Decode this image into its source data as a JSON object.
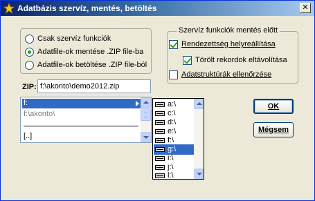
{
  "window": {
    "title": "Adatbázis szervíz, mentés, betöltés",
    "close_label": "✕"
  },
  "mode_options": [
    {
      "label": "Csak szervíz funkciók",
      "selected": false
    },
    {
      "label": "Adatfile-ok mentése .ZIP file-ba",
      "selected": true
    },
    {
      "label": "Adatfile-ok betöltése .ZIP file-ból",
      "selected": false
    }
  ],
  "service_group": {
    "legend": "Szervíz funkciók mentés előtt",
    "options": [
      {
        "label": "Rendezettség helyreállítása",
        "checked": true
      },
      {
        "label": "Törölt rekordok eltávolítása",
        "checked": true
      },
      {
        "label": "Adatstruktúrák ellenőrzése",
        "checked": false
      }
    ]
  },
  "zip": {
    "label": "ZIP:",
    "value": "f:\\akonto\\demo2012.zip"
  },
  "dir_list": [
    "f:",
    "f:\\akonto\\",
    "[..]"
  ],
  "drive_list": [
    "a:\\",
    "c:\\",
    "d:\\",
    "e:\\",
    "f:\\",
    "g:\\",
    "i:\\",
    "j:\\",
    "l:\\"
  ],
  "drive_selected": "g:\\",
  "buttons": {
    "ok": "OK",
    "cancel": "Mégsem"
  },
  "colors": {
    "selection": "#316ac5",
    "check": "#21a121",
    "title_start": "#0a246a",
    "title_end": "#a6caf0"
  }
}
